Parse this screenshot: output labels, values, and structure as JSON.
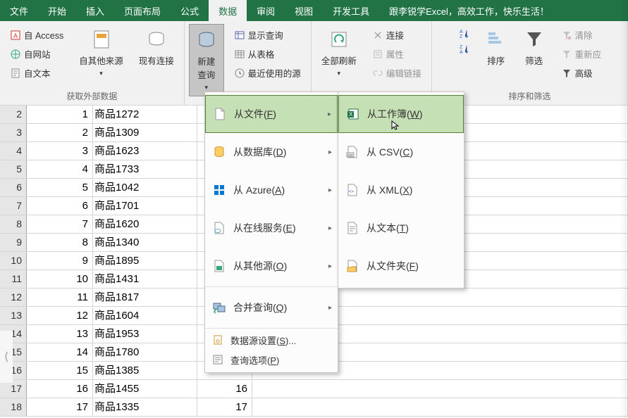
{
  "tabs": [
    "文件",
    "开始",
    "插入",
    "页面布局",
    "公式",
    "数据",
    "审阅",
    "视图",
    "开发工具",
    "跟李锐学Excel，高效工作，快乐生活！"
  ],
  "active_tab": 5,
  "ribbon": {
    "group_ext": {
      "label": "获取外部数据",
      "access": "自 Access",
      "web": "自网站",
      "text": "自文本",
      "other": "自其他来源",
      "existing": "现有连接"
    },
    "group_query": {
      "new_query": "新建\n查询",
      "show_query": "显示查询",
      "from_table": "从表格",
      "recent": "最近使用的源"
    },
    "group_conn": {
      "refresh": "全部刷新",
      "connections": "连接",
      "properties": "属性",
      "edit_links": "编辑链接"
    },
    "group_sort": {
      "label": "排序和筛选",
      "sort": "排序",
      "filter": "筛选",
      "clear": "清除",
      "reapply": "重新应",
      "advanced": "高级"
    }
  },
  "rows": [
    {
      "n": 2,
      "a": 1,
      "b": "商品1272",
      "c": ""
    },
    {
      "n": 3,
      "a": 2,
      "b": "商品1309",
      "c": ""
    },
    {
      "n": 4,
      "a": 3,
      "b": "商品1623",
      "c": ""
    },
    {
      "n": 5,
      "a": 4,
      "b": "商品1733",
      "c": ""
    },
    {
      "n": 6,
      "a": 5,
      "b": "商品1042",
      "c": ""
    },
    {
      "n": 7,
      "a": 6,
      "b": "商品1701",
      "c": ""
    },
    {
      "n": 8,
      "a": 7,
      "b": "商品1620",
      "c": ""
    },
    {
      "n": 9,
      "a": 8,
      "b": "商品1340",
      "c": ""
    },
    {
      "n": 10,
      "a": 9,
      "b": "商品1895",
      "c": ""
    },
    {
      "n": 11,
      "a": 10,
      "b": "商品1431",
      "c": ""
    },
    {
      "n": 12,
      "a": 11,
      "b": "商品1817",
      "c": ""
    },
    {
      "n": 13,
      "a": 12,
      "b": "商品1604",
      "c": ""
    },
    {
      "n": 14,
      "a": 13,
      "b": "商品1953",
      "c": ""
    },
    {
      "n": 15,
      "a": 14,
      "b": "商品1780",
      "c": ""
    },
    {
      "n": 16,
      "a": 15,
      "b": "商品1385",
      "c": ""
    },
    {
      "n": 17,
      "a": 16,
      "b": "商品1455",
      "c": "16"
    },
    {
      "n": 18,
      "a": 17,
      "b": "商品1335",
      "c": "17"
    }
  ],
  "menu1": {
    "from_file": "从文件(F)",
    "from_db": "从数据库(D)",
    "from_azure": "从 Azure(A)",
    "from_online": "从在线服务(E)",
    "from_other": "从其他源(O)",
    "combine": "合并查询(Q)",
    "ds_settings": "数据源设置(S)...",
    "query_opts": "查询选项(P)"
  },
  "menu2": {
    "from_workbook": "从工作簿(W)",
    "from_csv": "从 CSV(C)",
    "from_xml": "从 XML(X)",
    "from_text": "从文本(T)",
    "from_folder": "从文件夹(F)"
  }
}
